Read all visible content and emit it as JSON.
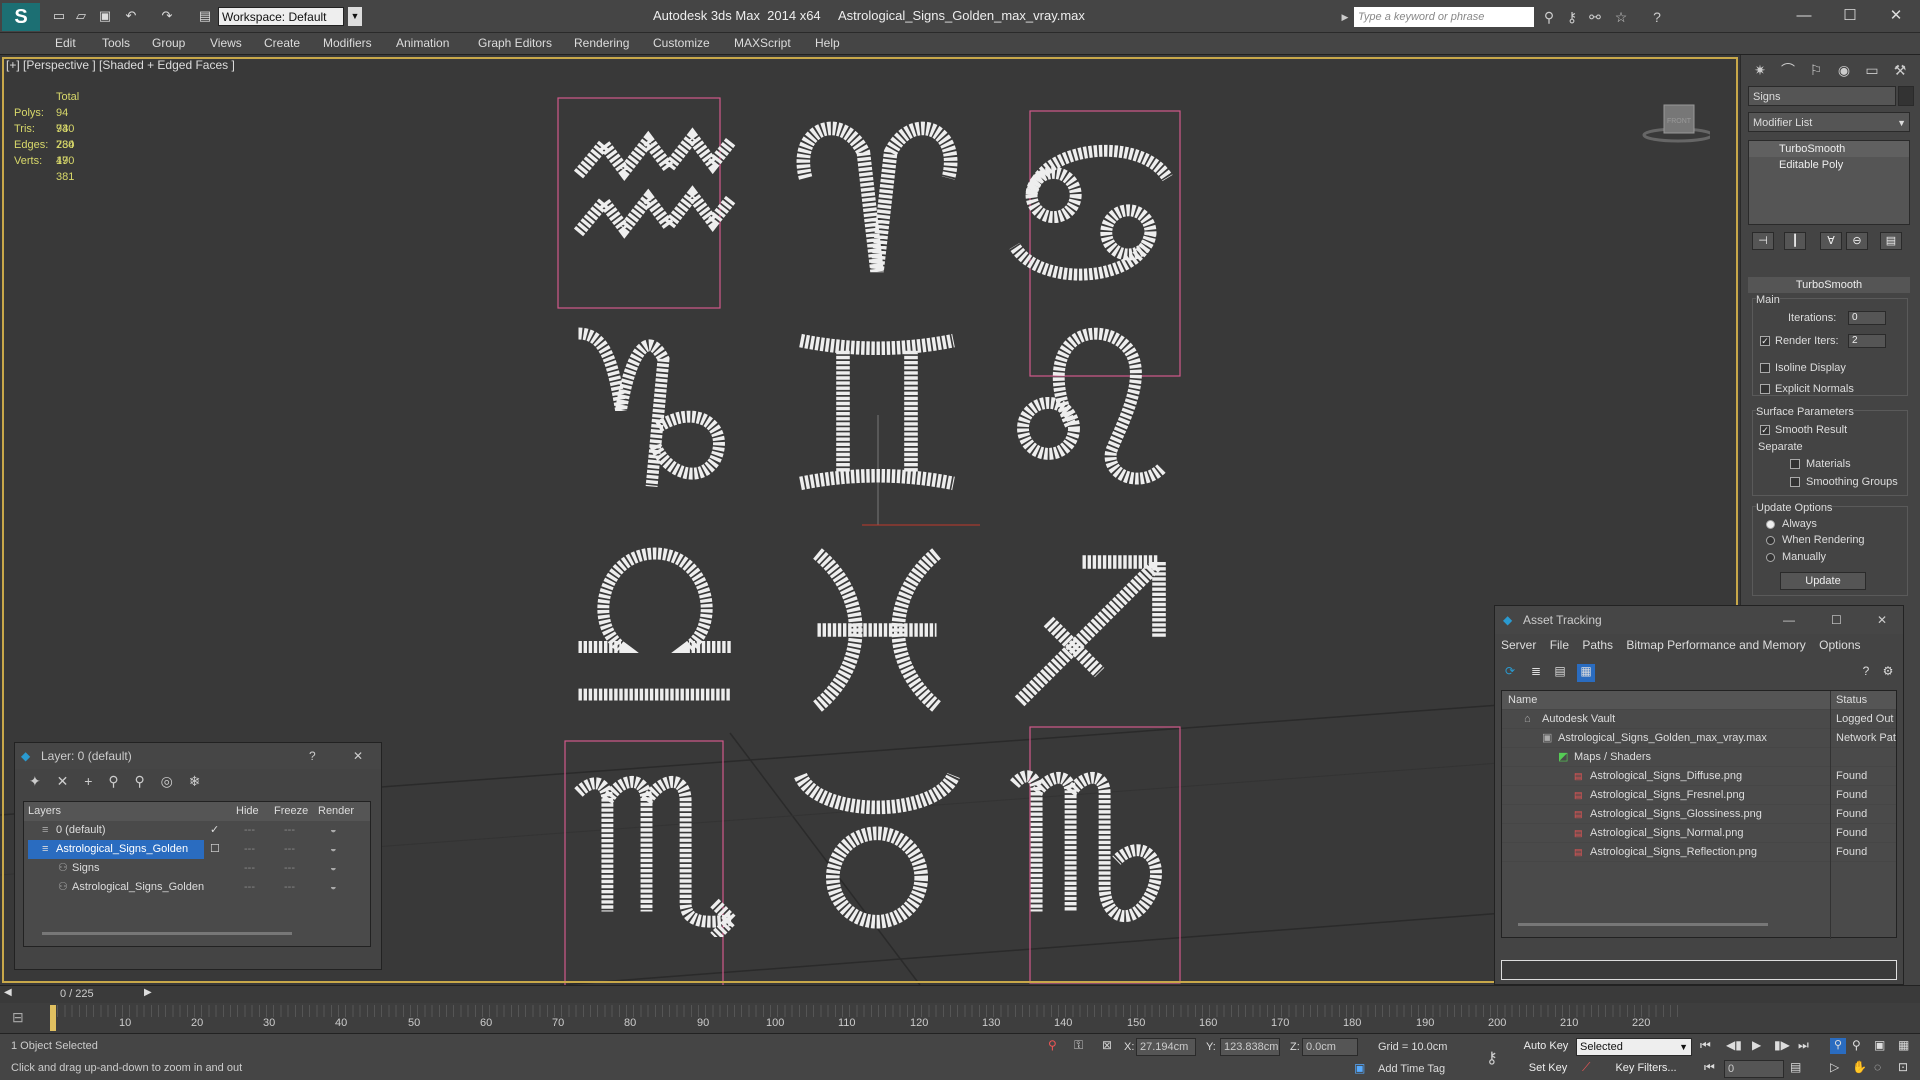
{
  "title": {
    "workspace": "Workspace: Default",
    "app": "Autodesk 3ds Max  2014 x64",
    "file": "Astrological_Signs_Golden_max_vray.max",
    "search_placeholder": "Type a keyword or phrase"
  },
  "menu": [
    "Edit",
    "Tools",
    "Group",
    "Views",
    "Create",
    "Modifiers",
    "Animation",
    "Graph Editors",
    "Rendering",
    "Customize",
    "MAXScript",
    "Help"
  ],
  "viewport": {
    "label": "[+] [Perspective ] [Shaded + Edged Faces ]",
    "stats_header": "Total",
    "stats": [
      {
        "k": "Polys:",
        "v": "94 730"
      },
      {
        "k": "Tris:",
        "v": "94 730"
      },
      {
        "k": "Edges:",
        "v": "284 190"
      },
      {
        "k": "Verts:",
        "v": "47 381"
      }
    ],
    "viewcube_label": "FRONT",
    "signs": [
      "aquarius-icon",
      "aries-icon",
      "cancer-icon",
      "capricorn-icon",
      "gemini-icon",
      "leo-icon",
      "libra-icon",
      "pisces-icon",
      "sagittarius-icon",
      "scorpio-icon",
      "taurus-icon",
      "virgo-icon"
    ]
  },
  "command_panel": {
    "object_name": "Signs",
    "modifier_list": "Modifier List",
    "stack": [
      "TurboSmooth",
      "Editable Poly"
    ],
    "rollout": "TurboSmooth",
    "main_label": "Main",
    "iterations_label": "Iterations:",
    "iterations": "0",
    "render_iters_label": "Render Iters:",
    "render_iters": "2",
    "isoline": "Isoline Display",
    "explicit": "Explicit Normals",
    "surface_params": "Surface Parameters",
    "smooth_result": "Smooth Result",
    "separate": "Separate",
    "materials": "Materials",
    "smoothing_groups": "Smoothing Groups",
    "update_options": "Update Options",
    "always": "Always",
    "when_rendering": "When Rendering",
    "manually": "Manually",
    "update_btn": "Update"
  },
  "asset_tracking": {
    "title": "Asset Tracking",
    "menu": [
      "Server",
      "File",
      "Paths",
      "Bitmap Performance and Memory",
      "Options"
    ],
    "col_name": "Name",
    "col_status": "Status",
    "rows": [
      {
        "name": "Autodesk Vault",
        "status": "Logged Out",
        "indent": 1
      },
      {
        "name": "Astrological_Signs_Golden_max_vray.max",
        "status": "Network Pat",
        "indent": 2
      },
      {
        "name": "Maps / Shaders",
        "status": "",
        "indent": 3
      },
      {
        "name": "Astrological_Signs_Diffuse.png",
        "status": "Found",
        "indent": 4
      },
      {
        "name": "Astrological_Signs_Fresnel.png",
        "status": "Found",
        "indent": 4
      },
      {
        "name": "Astrological_Signs_Glossiness.png",
        "status": "Found",
        "indent": 4
      },
      {
        "name": "Astrological_Signs_Normal.png",
        "status": "Found",
        "indent": 4
      },
      {
        "name": "Astrological_Signs_Reflection.png",
        "status": "Found",
        "indent": 4
      }
    ]
  },
  "layer_window": {
    "title": "Layer: 0 (default)",
    "help": "?",
    "col_layers": "Layers",
    "col_hide": "Hide",
    "col_freeze": "Freeze",
    "col_render": "Render",
    "rows": [
      {
        "name": "0 (default)",
        "indent": 1,
        "selected": false
      },
      {
        "name": "Astrological_Signs_Golden",
        "indent": 1,
        "selected": true
      },
      {
        "name": "Signs",
        "indent": 2,
        "selected": false
      },
      {
        "name": "Astrological_Signs_Golden",
        "indent": 2,
        "selected": false
      }
    ]
  },
  "timeline": {
    "frame": "0 / 225",
    "ticks": [
      "10",
      "20",
      "30",
      "40",
      "50",
      "60",
      "70",
      "80",
      "90",
      "100",
      "110",
      "120",
      "130",
      "140",
      "150",
      "160",
      "170",
      "180",
      "190",
      "200",
      "210",
      "220"
    ]
  },
  "status": {
    "selected": "1 Object Selected",
    "hint": "Click and drag up-and-down to zoom in and out",
    "x_label": "X:",
    "x": "27.194cm",
    "y_label": "Y:",
    "y": "123.838cm",
    "z_label": "Z:",
    "z": "0.0cm",
    "grid": "Grid = 10.0cm",
    "add_time_tag": "Add Time Tag",
    "auto_key": "Auto Key",
    "set_key": "Set Key",
    "selected_dd": "Selected",
    "key_filters": "Key Filters...",
    "frame_num": "0"
  }
}
